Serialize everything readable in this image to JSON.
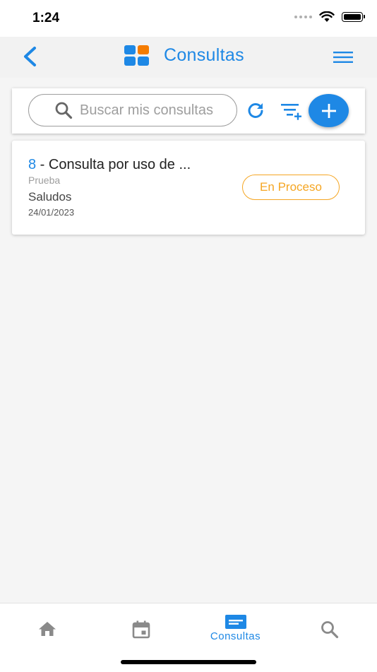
{
  "status_bar": {
    "time": "1:24"
  },
  "header": {
    "title": "Consultas",
    "logo_colors": [
      "#1e88e5",
      "#f57c00",
      "#1e88e5",
      "#1e88e5"
    ]
  },
  "toolbar": {
    "search_placeholder": "Buscar mis consultas"
  },
  "consultas": [
    {
      "id": "8",
      "title": " - Consulta por uso de ...",
      "subtitle": "Prueba",
      "message": "Saludos",
      "date": "24/01/2023",
      "status": "En Proceso"
    }
  ],
  "bottom_nav": {
    "items": [
      {
        "icon": "home-icon",
        "label": ""
      },
      {
        "icon": "calendar-icon",
        "label": ""
      },
      {
        "icon": "consultas-icon",
        "label": "Consultas",
        "active": true
      },
      {
        "icon": "search-icon",
        "label": ""
      }
    ]
  },
  "colors": {
    "accent": "#1e88e5",
    "status_pending": "#f5a623",
    "inactive_icon": "#8a8a8a"
  }
}
